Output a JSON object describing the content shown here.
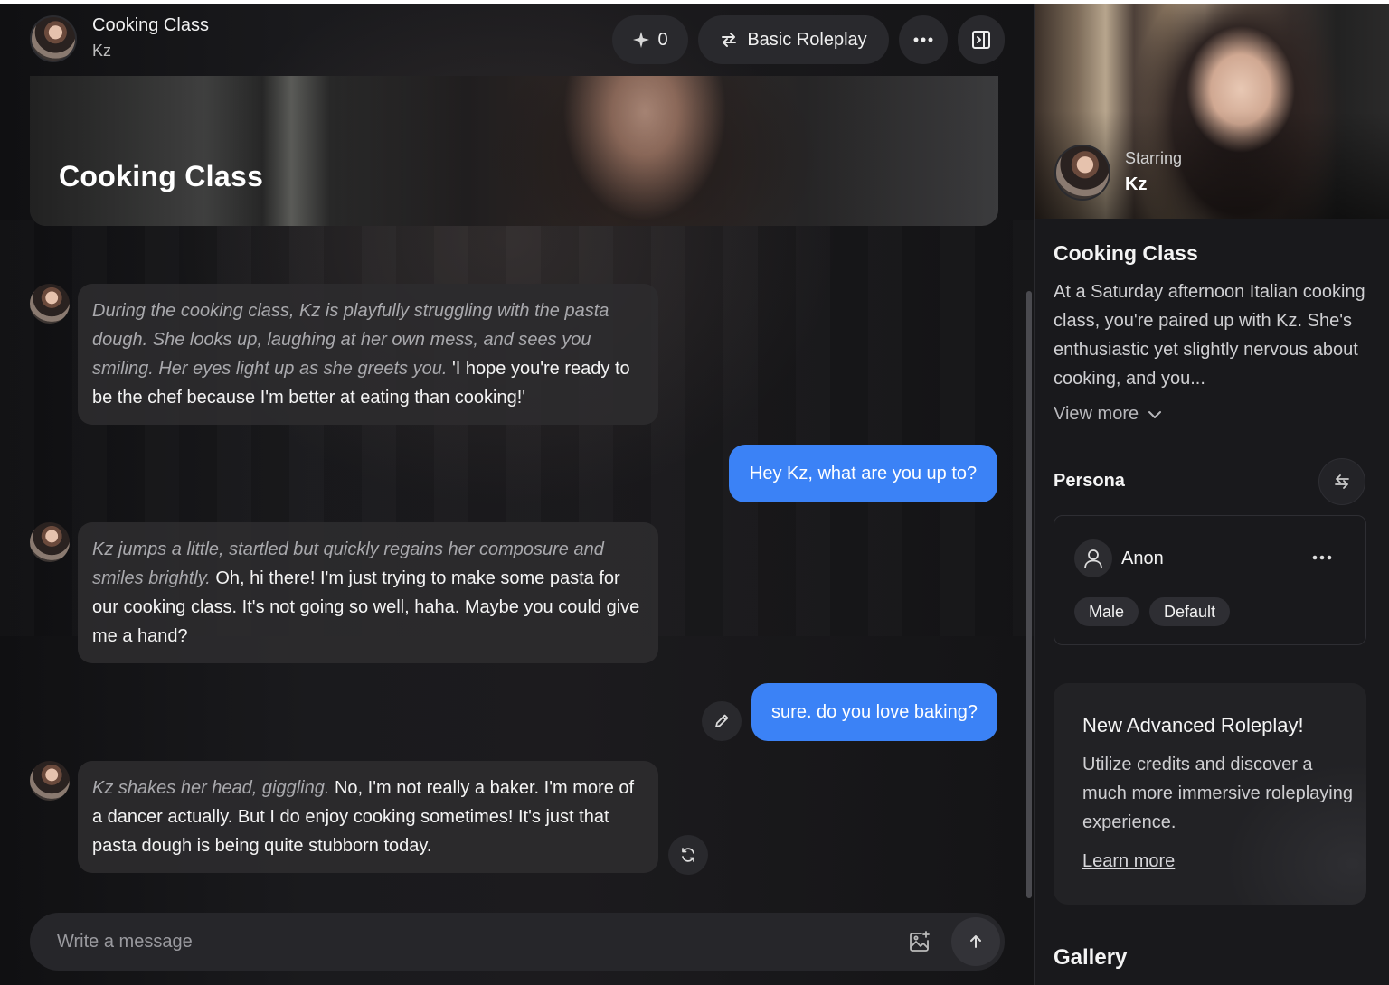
{
  "header": {
    "title": "Cooking Class",
    "character": "Kz",
    "credits": "0",
    "mode_label": "Basic Roleplay"
  },
  "banner": {
    "title": "Cooking Class"
  },
  "messages": [
    {
      "role": "ai",
      "action": "During the cooking class, Kz is playfully struggling with the pasta dough. She looks up, laughing at her own mess, and sees you smiling. Her eyes light up as she greets you.",
      "speech": "'I hope you're ready to be the chef because I'm better at eating than cooking!'"
    },
    {
      "role": "user",
      "text": "Hey Kz, what are you up to?"
    },
    {
      "role": "ai",
      "action": "Kz jumps a little, startled but quickly regains her composure and smiles brightly.",
      "speech": "Oh, hi there! I'm just trying to make some pasta for our cooking class. It's not going so well, haha. Maybe you could give me a hand?"
    },
    {
      "role": "user",
      "text": "sure. do you love baking?"
    },
    {
      "role": "ai",
      "action": "Kz shakes her head, giggling.",
      "speech": "No, I'm not really a baker. I'm more of a dancer actually. But I do enjoy cooking sometimes! It's just that pasta dough is being quite stubborn today."
    }
  ],
  "composer": {
    "placeholder": "Write a message"
  },
  "sidebar": {
    "starring_label": "Starring",
    "starring_name": "Kz",
    "title": "Cooking Class",
    "description": "At a Saturday afternoon Italian cooking class, you're paired up with Kz. She's enthusiastic yet slightly nervous about cooking, and you...",
    "view_more": "View more",
    "persona": {
      "heading": "Persona",
      "name": "Anon",
      "tags": [
        "Male",
        "Default"
      ]
    },
    "promo": {
      "title": "New Advanced Roleplay!",
      "text": "Utilize credits and discover a much more immersive roleplaying experience.",
      "link": "Learn more"
    },
    "gallery_heading": "Gallery"
  },
  "colors": {
    "accent_blue": "#3b82f6",
    "background": "#131316",
    "bubble": "#2c2b2e"
  },
  "icons": [
    "sparkle-icon",
    "swap-arrows-icon",
    "more-dots-icon",
    "side-panel-icon",
    "pencil-icon",
    "refresh-icon",
    "image-add-icon",
    "arrow-up-icon",
    "chevron-down-icon",
    "user-icon"
  ]
}
